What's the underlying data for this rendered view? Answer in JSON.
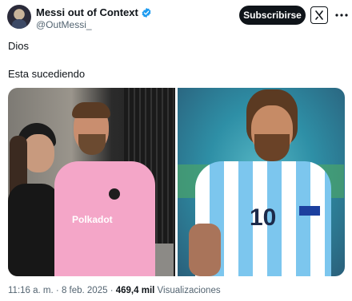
{
  "tweet": {
    "author": {
      "display_name": "Messi out of Context",
      "handle": "@OutMessi_",
      "verified_icon": "verified-badge-icon"
    },
    "actions": {
      "subscribe_label": "Subscribirse",
      "grok_icon": "grok-icon",
      "more_icon": "more-dots-icon"
    },
    "text_lines": [
      "Dios",
      "Esta sucediendo"
    ],
    "media": [
      {
        "kind": "photo",
        "jersey_text": "Polkadot",
        "jersey_color": "#f4a6c8"
      },
      {
        "kind": "photo",
        "jersey_number": "10",
        "jersey_colors": [
          "#7cc6ee",
          "#ffffff"
        ]
      }
    ],
    "meta": {
      "time": "11:16 a. m.",
      "date": "8 feb. 2025",
      "separator": "·",
      "views_count": "469,4 mil",
      "views_label": "Visualizaciones"
    }
  },
  "colors": {
    "text_primary": "#0f1419",
    "text_secondary": "#536471",
    "verified_blue": "#1d9bf0"
  }
}
